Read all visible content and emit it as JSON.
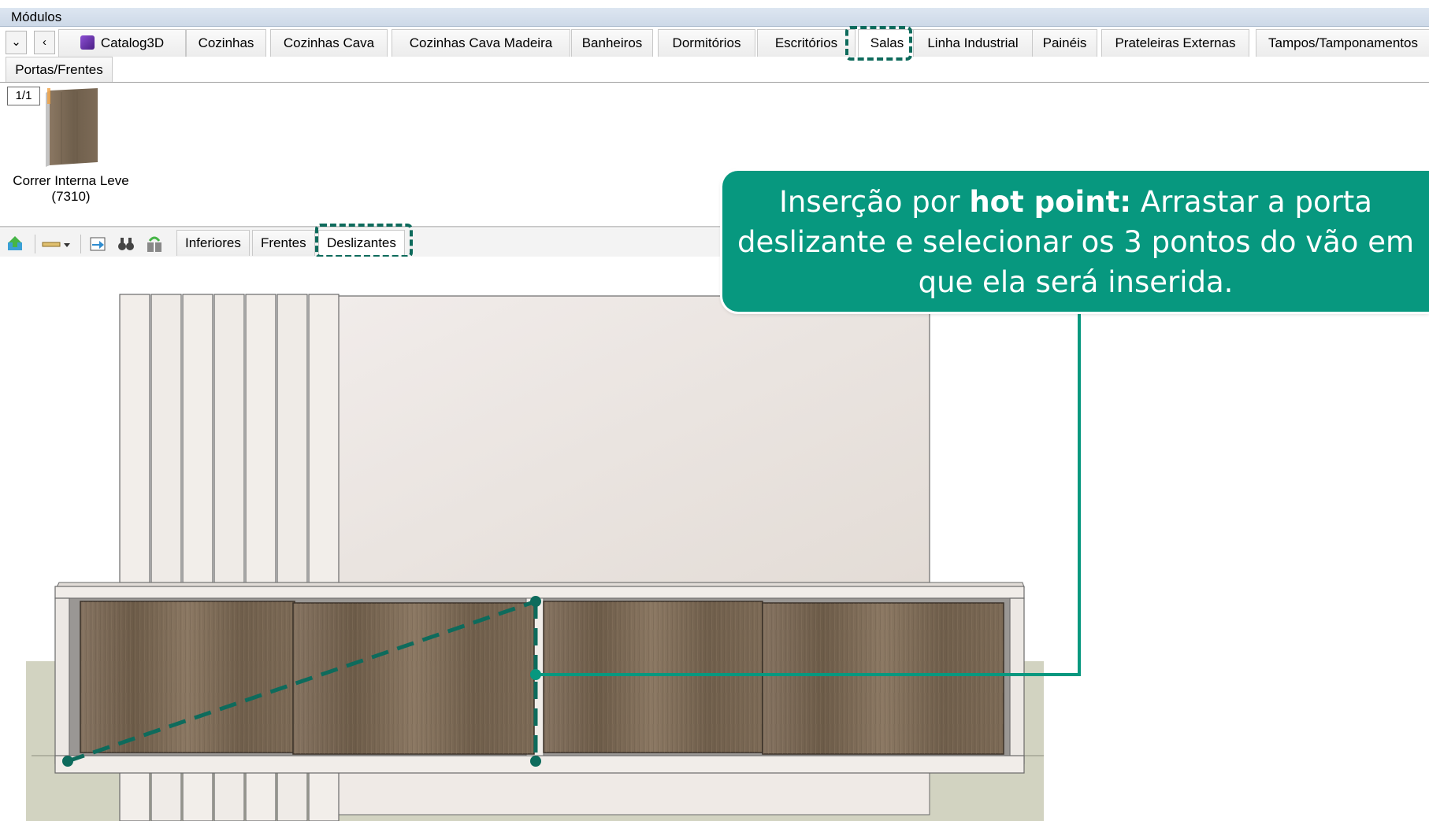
{
  "window": {
    "title": "Módulos"
  },
  "nav": {
    "dropdown": "⌄",
    "back": "‹"
  },
  "tabs": [
    "Catalog3D",
    "Cozinhas",
    "Cozinhas Cava",
    "Cozinhas Cava Madeira",
    "Banheiros",
    "Dormitórios",
    "Escritórios",
    "Salas",
    "Linha Industrial",
    "Painéis",
    "Prateleiras Externas",
    "Tampos/Tamponamentos"
  ],
  "tabs_row2": [
    "Portas/Frentes"
  ],
  "active_tab": "Salas",
  "catalog": {
    "pager": "1/1",
    "item": {
      "name": "Correr Interna Leve",
      "code": "(7310)"
    }
  },
  "subtabs": [
    "Inferiores",
    "Frentes",
    "Deslizantes"
  ],
  "active_subtab": "Deslizantes",
  "callout": {
    "prefix": "Inserção por ",
    "bold": "hot point:",
    "rest": " Arrastar a porta deslizante e selecionar os 3 pontos do vão em que ela será inserida."
  },
  "colors": {
    "accent": "#07987f",
    "accent_dark": "#0e6b5c",
    "wood": "#7b6a55",
    "wall": "#ece6e1",
    "floor": "#cfd0be"
  }
}
